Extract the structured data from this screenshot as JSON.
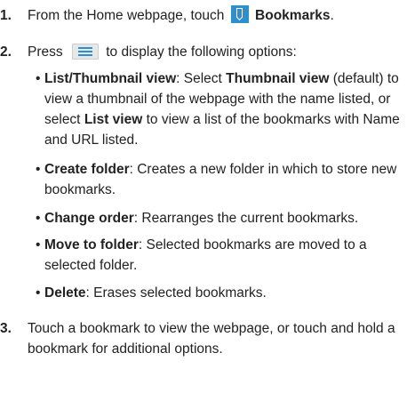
{
  "steps": [
    {
      "num": "1.",
      "pre": "From the Home webpage, touch",
      "icon": "bookmarks-icon",
      "bold": "Bookmarks",
      "post": "."
    },
    {
      "num": "2.",
      "pre": "Press",
      "icon": "menu-icon",
      "post": "to display the following options:",
      "bullets": [
        {
          "term": "List/Thumbnail view",
          "l1": ": Select ",
          "b1": "Thumbnail view",
          "l2": " (default) to view a thumbnail of the webpage with the name listed, or select ",
          "b2": "List view",
          "l3": " to view a list of the bookmarks with Name and URL listed."
        },
        {
          "term": "Create folder",
          "desc": ": Creates a new folder in which to store new bookmarks."
        },
        {
          "term": "Change order",
          "desc": ": Rearranges the current bookmarks."
        },
        {
          "term": "Move to folder",
          "desc": ": Selected bookmarks are moved to a selected folder."
        },
        {
          "term": "Delete",
          "desc": ": Erases selected bookmarks."
        }
      ]
    },
    {
      "num": "3.",
      "text": "Touch a bookmark to view the webpage, or touch and hold a bookmark for additional options."
    }
  ],
  "colors": {
    "icon_blue": "#2e8fcf",
    "text": "#222222"
  }
}
